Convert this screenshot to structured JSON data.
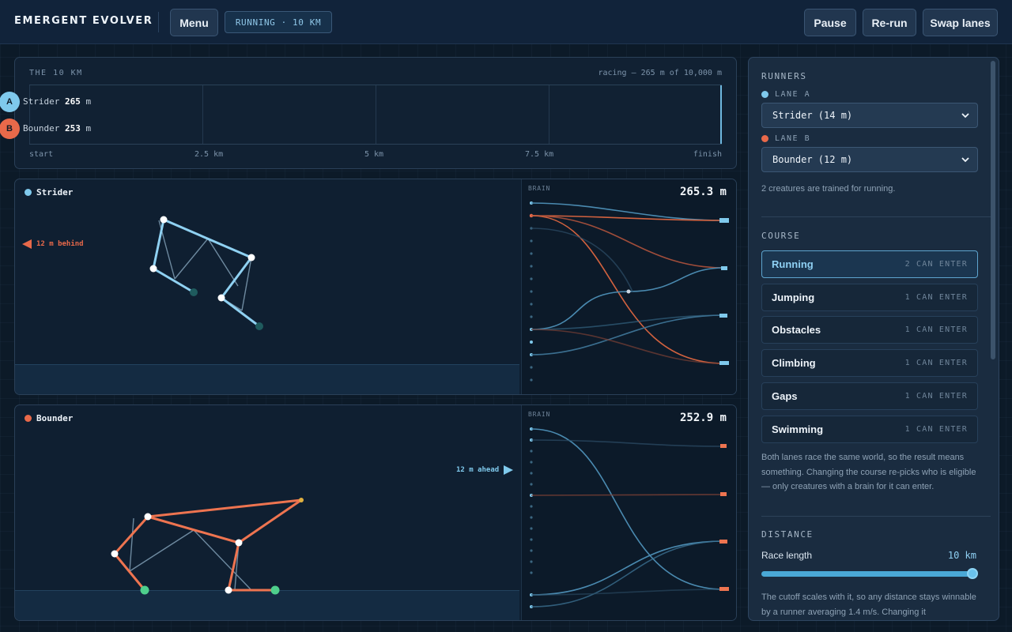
{
  "header": {
    "app_title": "EMERGENT EVOLVER",
    "menu_label": "Menu",
    "status": "RUNNING · 10 KM",
    "pause_label": "Pause",
    "rerun_label": "Re-run",
    "swap_label": "Swap lanes"
  },
  "track": {
    "title": "THE 10 KM",
    "status": "racing — 265 m of 10,000 m",
    "ticks": [
      "start",
      "2.5 km",
      "5 km",
      "7.5 km",
      "finish"
    ],
    "lane_a": {
      "badge": "A",
      "name": "Strider",
      "distance": "265",
      "unit": "m"
    },
    "lane_b": {
      "badge": "B",
      "name": "Bounder",
      "distance": "253",
      "unit": "m"
    },
    "progress_fraction": 0.0265
  },
  "creatures": {
    "strider": {
      "name": "Strider",
      "brain_label": "BRAIN",
      "distance": "265.3 m",
      "gap_note": "12 m behind"
    },
    "bounder": {
      "name": "Bounder",
      "brain_label": "BRAIN",
      "distance": "252.9 m",
      "gap_note": "12 m ahead"
    }
  },
  "sidebar": {
    "runners_title": "RUNNERS",
    "lane_a_label": "LANE A",
    "lane_a_value": "Strider (14 m)",
    "lane_b_label": "LANE B",
    "lane_b_value": "Bounder (12 m)",
    "runners_note": "2 creatures are trained for running.",
    "course_title": "COURSE",
    "courses": [
      {
        "name": "Running",
        "meta": "2 CAN ENTER"
      },
      {
        "name": "Jumping",
        "meta": "1 CAN ENTER"
      },
      {
        "name": "Obstacles",
        "meta": "1 CAN ENTER"
      },
      {
        "name": "Climbing",
        "meta": "1 CAN ENTER"
      },
      {
        "name": "Gaps",
        "meta": "1 CAN ENTER"
      },
      {
        "name": "Swimming",
        "meta": "1 CAN ENTER"
      }
    ],
    "course_note": "Both lanes race the same world, so the result means something. Changing the course re-picks who is eligible — only creatures with a brain for it can enter.",
    "distance_title": "DISTANCE",
    "race_length_label": "Race length",
    "race_length_value": "10 km",
    "distance_note": "The cutoff scales with it, so any distance stays winnable by a runner averaging 1.4 m/s. Changing it"
  },
  "colors": {
    "lane_a": "#7fc9ec",
    "lane_b": "#e8694a",
    "accent": "#4aa8d6"
  }
}
